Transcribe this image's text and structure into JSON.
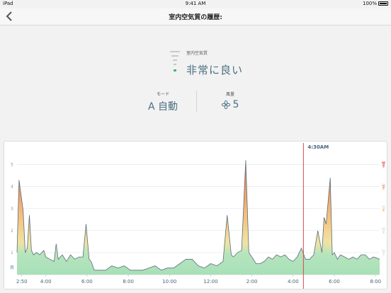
{
  "status": {
    "device": "iPad",
    "time": "9:41 AM",
    "battery": "100%"
  },
  "nav": {
    "title": "室内空気質の履歴:"
  },
  "air_quality": {
    "label": "室内空気質",
    "value": "非常に良い",
    "level": 1
  },
  "mode": {
    "label": "モード",
    "value": "A 自動"
  },
  "fan": {
    "label": "風量",
    "value": "5"
  },
  "colors": {
    "accent": "#4a7082",
    "good": "#a8e0b8",
    "marker": "#d84a4a",
    "grid": "#e4e4e4"
  },
  "chart_data": {
    "type": "area",
    "marker": "4:30AM",
    "y_ticks": [
      "5",
      "4",
      "3",
      "2",
      "1"
    ],
    "y_bottom_label": "良",
    "ylim": [
      0,
      5.6
    ],
    "x_ticks": [
      "2:50",
      "4:00",
      "6:00",
      "8:00",
      "10:00",
      "12:00",
      "2:00",
      "4:00",
      "6:00",
      "8:00"
    ],
    "x_tick_hours": [
      2.833,
      4,
      6,
      8,
      10,
      12,
      14,
      16,
      18,
      20
    ],
    "marker_hour": 16.5,
    "xlim": [
      2.6,
      20.2
    ],
    "series": [
      {
        "x": [
          2.6,
          2.7,
          2.9,
          3.0,
          3.1,
          3.2,
          3.3,
          3.4,
          3.55,
          3.7,
          3.9,
          4.0,
          4.2,
          4.4,
          4.5,
          4.6,
          4.8,
          5.0,
          5.2,
          5.4,
          5.6,
          5.8,
          5.95,
          6.1,
          6.2,
          6.35,
          6.6,
          6.9,
          7.2,
          7.5,
          7.8,
          8.1,
          8.4,
          8.7,
          9.0,
          9.3,
          9.6,
          9.9,
          10.2,
          10.5,
          10.8,
          11.1,
          11.4,
          11.7,
          12.0,
          12.3,
          12.6,
          12.8,
          13.0,
          13.1,
          13.3,
          13.5,
          13.7,
          13.85,
          14.0,
          14.2,
          14.4,
          14.6,
          14.8,
          15.0,
          15.2,
          15.4,
          15.6,
          15.8,
          16.0,
          16.2,
          16.4,
          16.6,
          16.8,
          17.0,
          17.2,
          17.4,
          17.5,
          17.6,
          17.8,
          17.9,
          18.0,
          18.15,
          18.3,
          18.5,
          18.7,
          18.9,
          19.1,
          19.3,
          19.5,
          19.7,
          19.9,
          20.2
        ],
        "y": [
          1.0,
          4.3,
          2.9,
          1.0,
          1.2,
          2.7,
          1.1,
          0.9,
          1.0,
          0.9,
          1.1,
          0.8,
          0.7,
          0.6,
          1.4,
          0.7,
          0.9,
          0.6,
          0.9,
          0.7,
          0.8,
          0.8,
          2.3,
          0.7,
          0.6,
          0.2,
          0.2,
          0.2,
          0.4,
          0.3,
          0.4,
          0.2,
          0.2,
          0.2,
          0.3,
          0.4,
          0.2,
          0.3,
          0.3,
          0.5,
          0.7,
          0.7,
          0.4,
          0.3,
          0.5,
          0.4,
          0.6,
          2.7,
          0.9,
          0.8,
          1.0,
          1.1,
          5.2,
          1.0,
          0.8,
          0.5,
          0.5,
          0.6,
          0.8,
          0.7,
          0.9,
          0.8,
          0.9,
          0.7,
          0.6,
          0.8,
          1.2,
          0.7,
          0.7,
          0.9,
          2.0,
          1.0,
          2.6,
          2.3,
          4.4,
          0.9,
          1.0,
          0.7,
          0.9,
          0.8,
          0.7,
          0.8,
          0.7,
          0.9,
          0.9,
          0.7,
          0.8,
          0.7
        ]
      }
    ]
  }
}
